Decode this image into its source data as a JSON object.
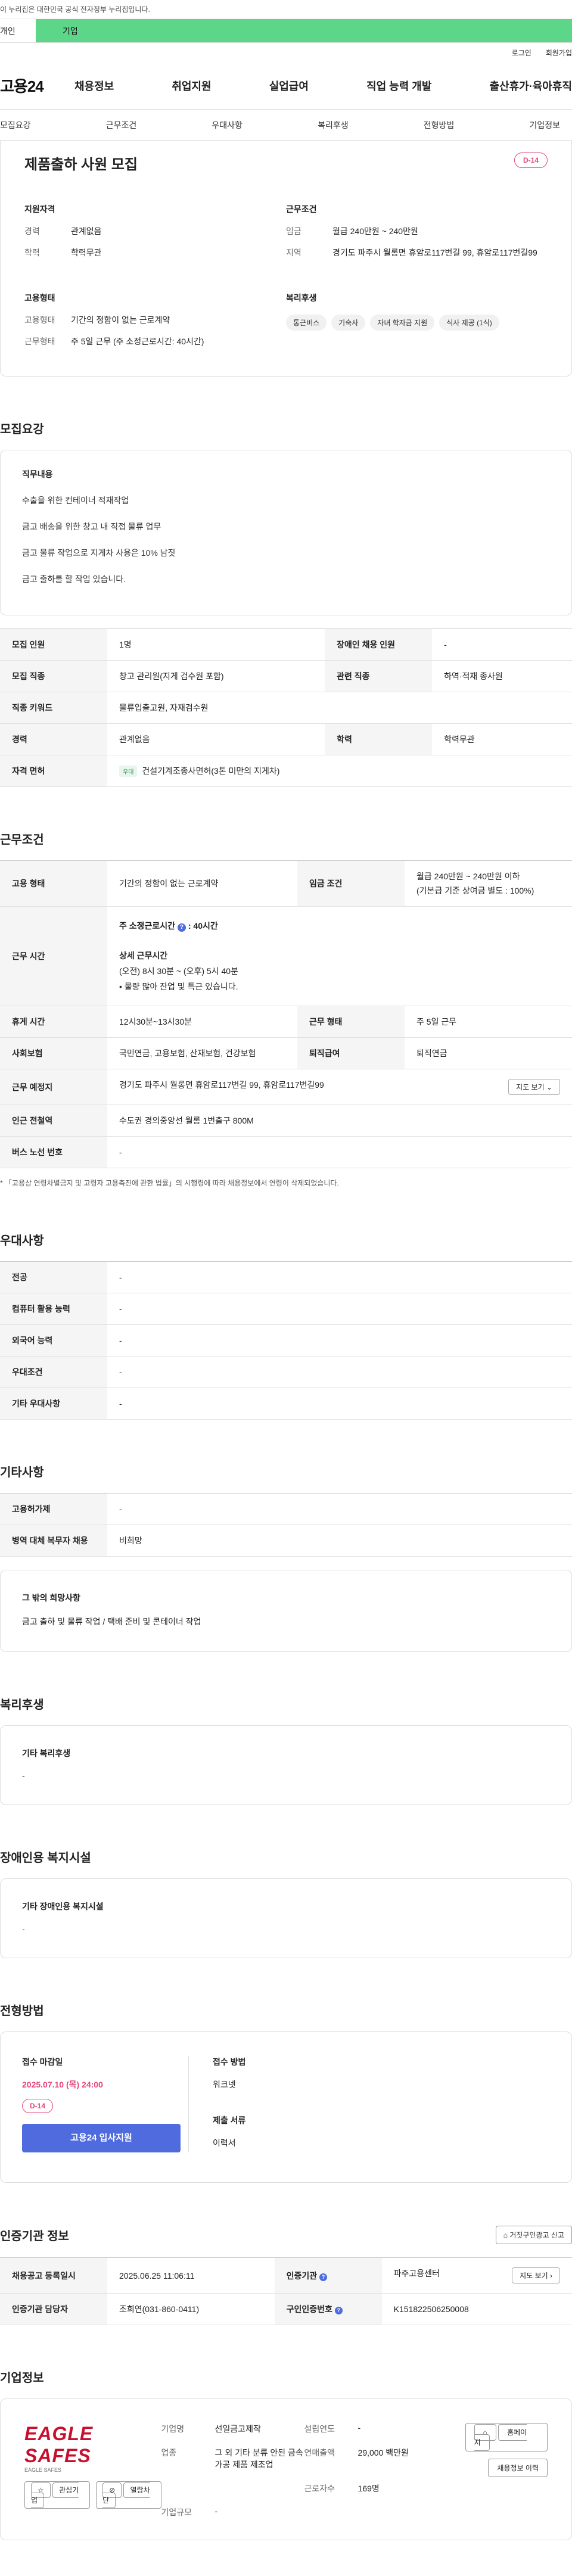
{
  "banner": "이 누리집은 대한민국 공식 전자정부 누리집입니다.",
  "tabs": {
    "individual": "개인",
    "corporate": "기업"
  },
  "util": {
    "login": "로그인",
    "join": "회원가입"
  },
  "gnb": {
    "logo": "고용24",
    "items": [
      "채용정보",
      "취업지원",
      "실업급여",
      "직업 능력 개발",
      "출산휴가·육아휴직"
    ]
  },
  "subnav": [
    "모집요강",
    "근무조건",
    "우대사항",
    "복리후생",
    "전형방법",
    "기업정보"
  ],
  "summary": {
    "title": "제품출하 사원 모집",
    "dday": "D-14",
    "qual_title": "지원자격",
    "qual": [
      {
        "k": "경력",
        "v": "관계없음"
      },
      {
        "k": "학력",
        "v": "학력무관"
      }
    ],
    "cond_title": "근무조건",
    "cond": [
      {
        "k": "임금",
        "v": "월급 240만원 ~ 240만원"
      },
      {
        "k": "지역",
        "v": "경기도 파주시 월롱면 휴암로117번길 99, 휴암로117번길99"
      }
    ],
    "emp_title": "고용형태",
    "emp": [
      {
        "k": "고용형태",
        "v": "기간의 정함이 없는 근로계약"
      },
      {
        "k": "근무형태",
        "v": "주 5일 근무 (주 소정근로시간: 40시간)"
      }
    ],
    "welfare_title": "복리후생",
    "welfare": [
      "통근버스",
      "기숙사",
      "자녀 학자금 지원",
      "식사 제공 (1식)"
    ]
  },
  "recruit": {
    "title": "모집요강",
    "duty_title": "직무내용",
    "duties": [
      "수출을 위한 컨테이너 적재작업",
      "금고 배송을 위한 창고 내 직접 물류 업무",
      "금고 물류 작업으로 지게차 사용은 10% 남짓",
      "금고 출하를 할 작업 있습니다."
    ],
    "rows": [
      {
        "h1": "모집 인원",
        "v1": "1명",
        "h2": "장애인 채용 인원",
        "v2": "-"
      },
      {
        "h1": "모집 직종",
        "v1": "창고 관리원(지게 검수원 포함)",
        "h2": "관련 직종",
        "v2": "하역·적재 종사원"
      },
      {
        "h1": "직종 키워드",
        "v1": "물류입출고원, 자재검수원"
      },
      {
        "h1": "경력",
        "v1": "관계없음",
        "h2": "학력",
        "v2": "학력무관"
      },
      {
        "h1": "자격 면허",
        "badge": "우대",
        "v1": "건설기계조종사면허(3톤 미만의 지게차)"
      }
    ]
  },
  "work": {
    "title": "근무조건",
    "emp_type_h": "고용 형태",
    "emp_type": "기간의 정함이 없는 근로계약",
    "wage_h": "임금 조건",
    "wage1": "월급 240만원 ~ 240만원 이하",
    "wage2": "(기본급 기준 상여금 별도 : 100%)",
    "hours_h": "근무 시간",
    "hours_week": "주 소정근로시간",
    "hours_week_val": "40시간",
    "hours_detail_h": "상세 근무시간",
    "hours_detail": "(오전) 8시 30분 ~ (오후) 5시 40분",
    "hours_note": "• 물량 많아 잔업 및 특근 있습니다.",
    "rest_h": "휴게 시간",
    "rest": "12시30분~13시30분",
    "shape_h": "근무 형태",
    "shape": "주 5일 근무",
    "insurance_h": "사회보험",
    "insurance": "국민연금, 고용보험, 산재보험, 건강보험",
    "retire_h": "퇴직급여",
    "retire": "퇴직연금",
    "place_h": "근무 예정지",
    "place": "경기도 파주시 월롱면 휴암로117번길 99, 휴암로117번길99",
    "map_btn": "지도 보기",
    "subway_h": "인근 전철역",
    "subway": "수도권 경의중앙선 월롱 1번출구 800M",
    "bus_h": "버스 노선 번호",
    "bus": "-",
    "note": "* 「고용상 연령차별금지 및 고령자 고용촉진에 관한 법률」의 시행령에 따라 채용정보에서 연령이 삭제되었습니다."
  },
  "pref": {
    "title": "우대사항",
    "rows": [
      {
        "h": "전공",
        "v": "-"
      },
      {
        "h": "컴퓨터 활용 능력",
        "v": "-"
      },
      {
        "h": "외국어 능력",
        "v": "-"
      },
      {
        "h": "우대조건",
        "v": "-"
      },
      {
        "h": "기타 우대사항",
        "v": "-"
      }
    ]
  },
  "etc": {
    "title": "기타사항",
    "rows": [
      {
        "h": "고용허가제",
        "v": "-"
      },
      {
        "h": "병역 대체 복무자 채용",
        "v": "비희망"
      }
    ],
    "other_title": "그 밖의 희망사항",
    "other": "금고 출하 및 물류 작업 / 택배 준비 및 콘테이너 작업"
  },
  "welfare": {
    "title": "복리후생",
    "sub": "기타 복리후생",
    "val": "-"
  },
  "disabled": {
    "title": "장애인용 복지시설",
    "sub": "기타 장애인용 복지시설",
    "val": "-"
  },
  "apply": {
    "title": "전형방법",
    "deadline_h": "접수 마감일",
    "deadline": "2025.07.10 (목) 24:00",
    "dday": "D-14",
    "btn": "고용24 입사지원",
    "method_h": "접수 방법",
    "method": "워크넷",
    "docs_h": "제출 서류",
    "docs": "이력서"
  },
  "agency": {
    "title": "인증기관 정보",
    "report": "거짓구인광고 신고",
    "reg_h": "채용공고 등록일시",
    "reg": "2025.06.25 11:06:11",
    "auth_h": "인증기관",
    "auth": "파주고용센터",
    "map": "지도 보기",
    "staff_h": "인증기관 담당자",
    "staff": "조희연(031-860-0411)",
    "id_h": "구인인증번호",
    "id": "K151822506250008"
  },
  "company": {
    "title": "기업정보",
    "logo": "EAGLE SAFES",
    "logo_sub": "EAGLE SAFES",
    "fav": "관심기업",
    "block": "열람차단",
    "name_h": "기업명",
    "name": "선일금고제작",
    "since_h": "설립연도",
    "since": "-",
    "biz_h": "업종",
    "biz": "그 외 기타 분류 안된 금속 가공 제품 제조업",
    "sales_h": "연매출액",
    "sales": "29,000 백만원",
    "emp_h": "근로자수",
    "emp": "169명",
    "scale_h": "기업규모",
    "scale": "-",
    "home": "홈페이지",
    "jobs": "채용정보 이력"
  }
}
